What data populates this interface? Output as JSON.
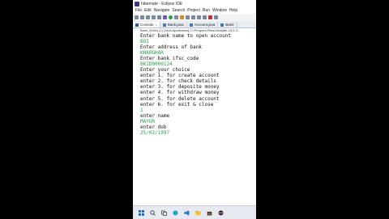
{
  "window": {
    "title": "hibernate - Eclipse IDE"
  },
  "menu": [
    "File",
    "Edit",
    "Navigate",
    "Search",
    "Project",
    "Run",
    "Window",
    "Help"
  ],
  "tabs": [
    {
      "label": "Console",
      "active": true,
      "icon": "console-icon"
    },
    {
      "label": "Bank.java",
      "active": false,
      "icon": "java-file-icon"
    },
    {
      "label": "Account.java",
      "active": false,
      "icon": "java-file-icon"
    },
    {
      "label": "Bank",
      "active": false,
      "icon": "java-file-icon"
    }
  ],
  "status_line": "Bank_Driver (1) [Java Application] C:\\Program Files\\Java\\jdk-18.0.1\\",
  "console_lines": [
    {
      "text": "Enter bank name to open account",
      "type": "output"
    },
    {
      "text": "BOI",
      "type": "input"
    },
    {
      "text": "Enter address of bank",
      "type": "output"
    },
    {
      "text": "KHARGHAR",
      "type": "input"
    },
    {
      "text": "Enter bank ifsc_code",
      "type": "output"
    },
    {
      "text": "BKID0000124",
      "type": "input"
    },
    {
      "text": "Enter your choice",
      "type": "output"
    },
    {
      "text": "enter 1. for create account",
      "type": "output"
    },
    {
      "text": "enter 2. for check details",
      "type": "output"
    },
    {
      "text": "enter 3. for deposite money",
      "type": "output"
    },
    {
      "text": "enter 4. for withdraw money",
      "type": "output"
    },
    {
      "text": "enter 5. for delete account",
      "type": "output"
    },
    {
      "text": "enter 6. for exit & close",
      "type": "output"
    },
    {
      "text": "1",
      "type": "input"
    },
    {
      "text": "enter name",
      "type": "output"
    },
    {
      "text": "MAYUR",
      "type": "input"
    },
    {
      "text": "enter dob",
      "type": "output"
    },
    {
      "text": "25/02/1997",
      "type": "input"
    }
  ],
  "colors": {
    "input_text": "#2aa04a",
    "output_text": "#111111"
  }
}
